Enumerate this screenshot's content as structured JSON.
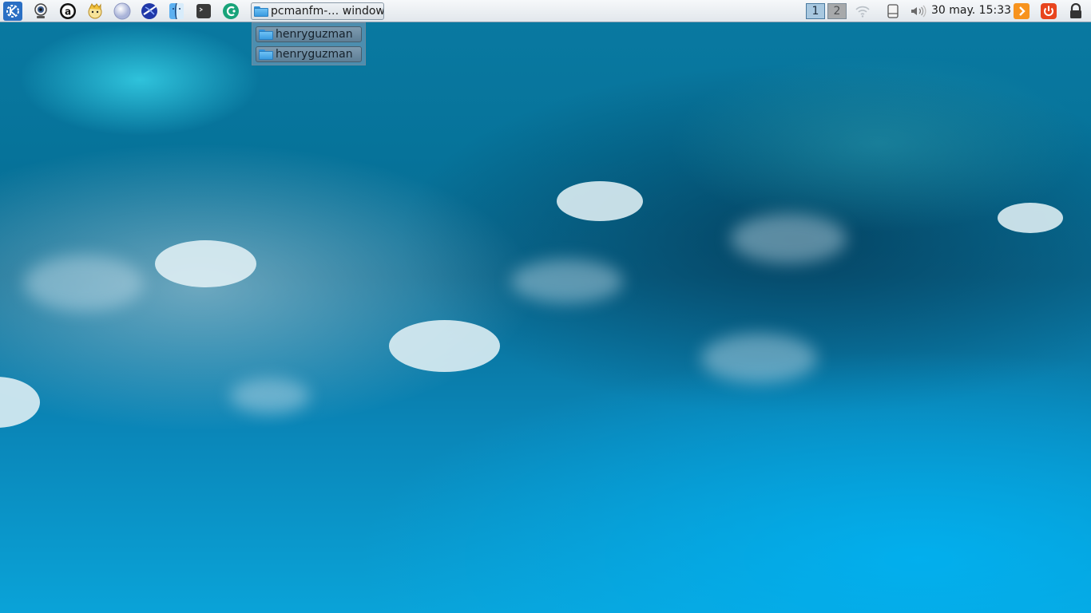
{
  "panel": {
    "launchers": [
      {
        "name": "kde-menu-icon"
      },
      {
        "name": "webcam-icon"
      },
      {
        "name": "app-a-icon"
      },
      {
        "name": "character-app-icon"
      },
      {
        "name": "globe-icon"
      },
      {
        "name": "browser-icon"
      },
      {
        "name": "finder-icon"
      },
      {
        "name": "terminal-icon"
      },
      {
        "name": "green-app-icon"
      }
    ],
    "task_button": {
      "label": "pcmanfm-… windows"
    },
    "desktops": [
      "1",
      "2"
    ],
    "clock": "30 may. 15:33"
  },
  "task_popup": {
    "items": [
      {
        "label": "henryguzman"
      },
      {
        "label": "henryguzman"
      }
    ]
  },
  "colors": {
    "panel": "#e6ebf0",
    "accent_orange": "#f7931e",
    "power_red": "#e8451e"
  }
}
